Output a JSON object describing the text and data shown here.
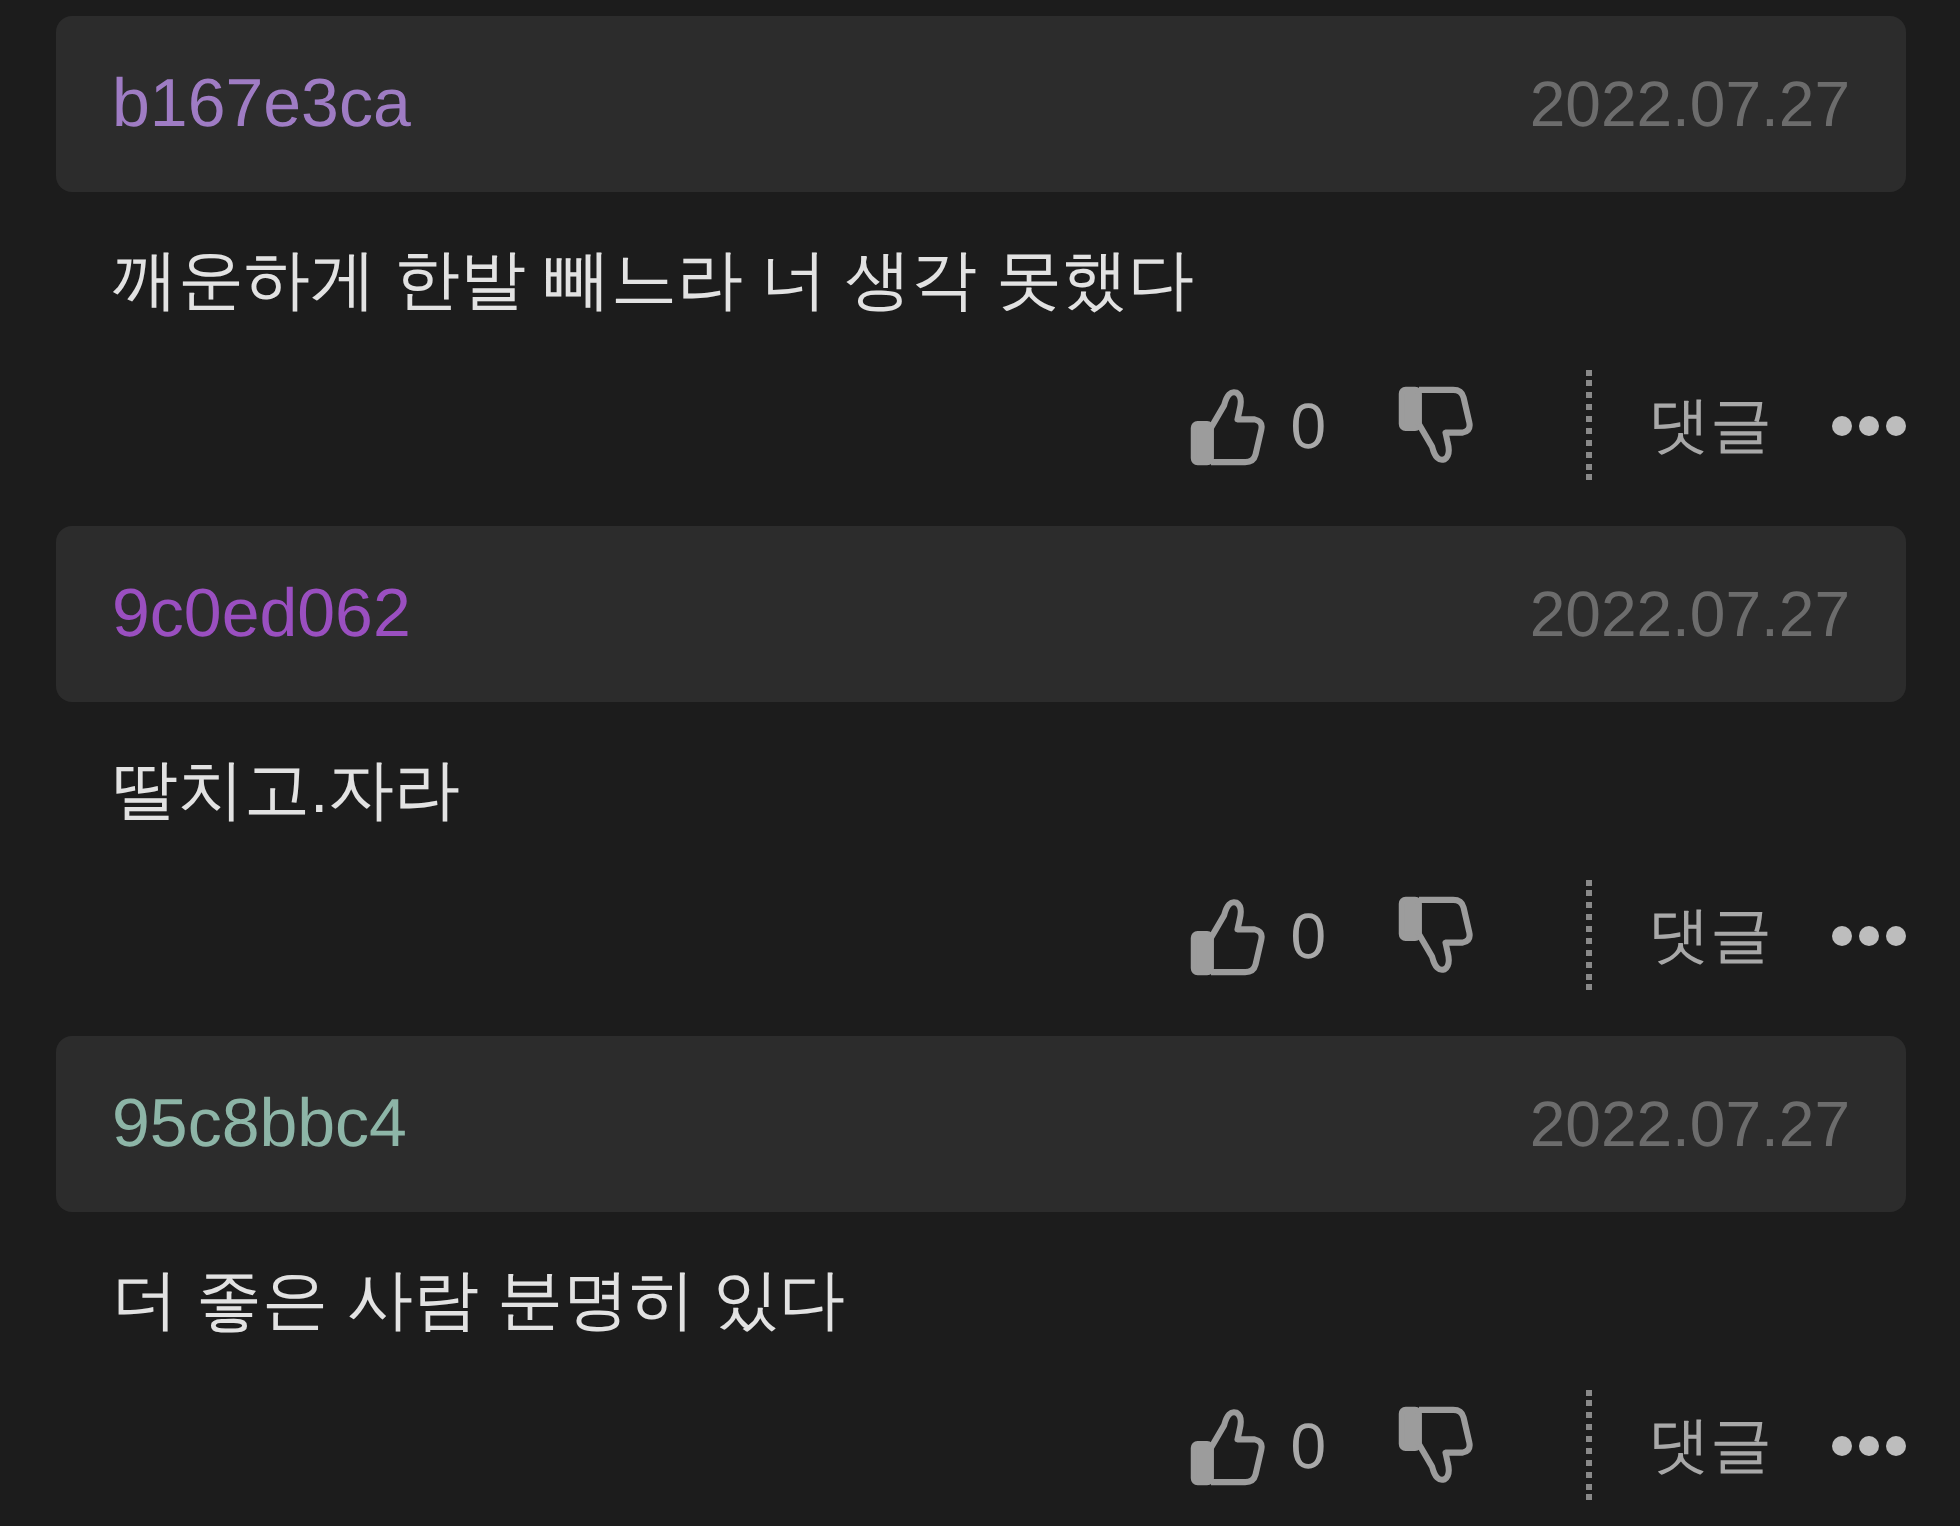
{
  "comments": [
    {
      "author": {
        "name": "b167e3ca",
        "color": "#9f7cc4"
      },
      "date": "2022.07.27",
      "text": "깨운하게 한발 빼느라 너 생각 못했다",
      "likes": "0",
      "reply_label": "댓글"
    },
    {
      "author": {
        "name": "9c0ed062",
        "color": "#9a4fc0"
      },
      "date": "2022.07.27",
      "text": "딸치고.자라",
      "likes": "0",
      "reply_label": "댓글"
    },
    {
      "author": {
        "name": "95c8bbc4",
        "color": "#8db5a7"
      },
      "date": "2022.07.27",
      "text": "더 좋은 사람 분명히 있다",
      "likes": "0",
      "reply_label": "댓글"
    }
  ]
}
